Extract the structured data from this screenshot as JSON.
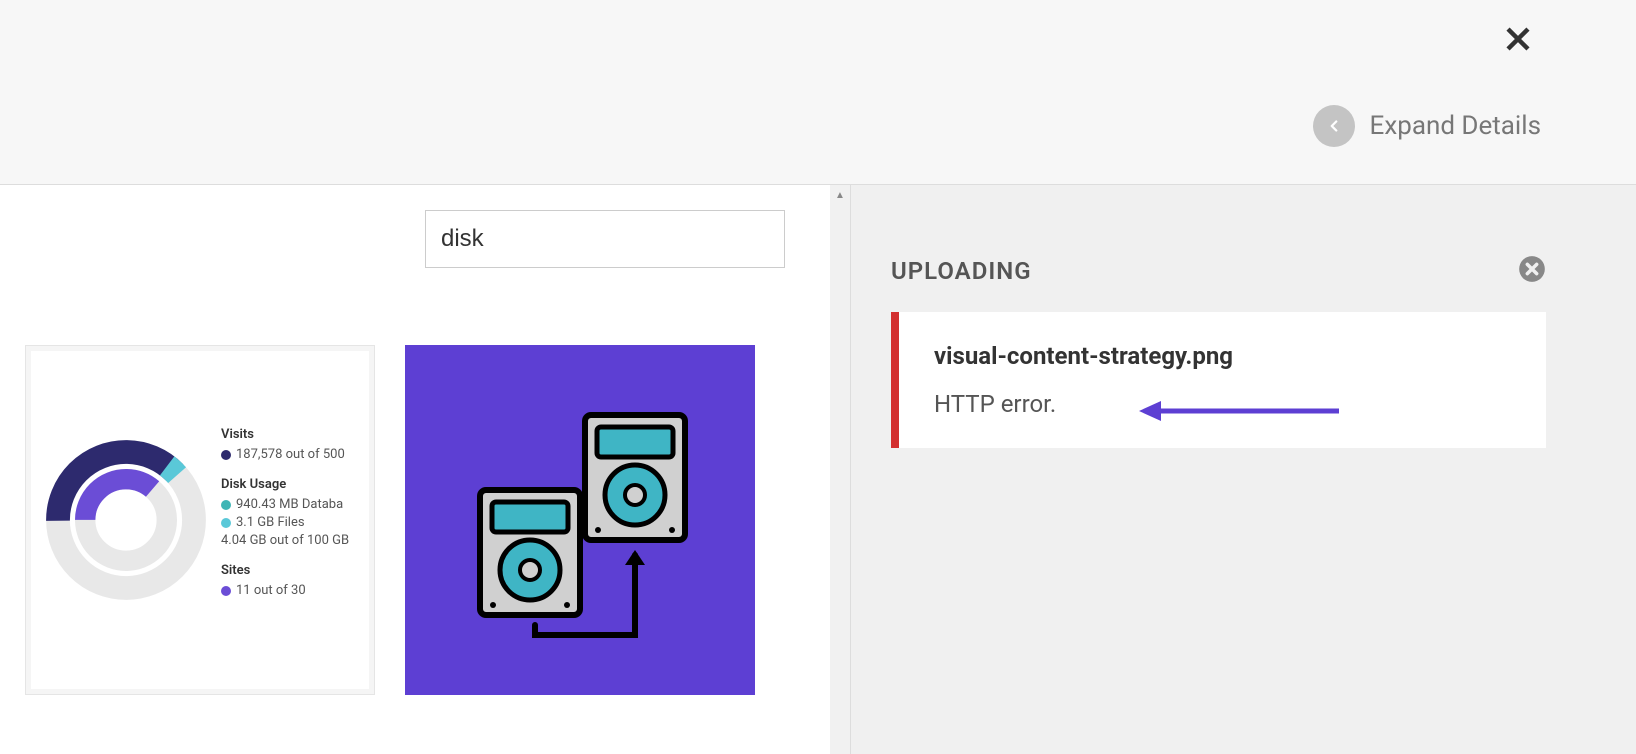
{
  "header": {
    "expand_label": "Expand Details"
  },
  "search": {
    "value": "disk"
  },
  "media": {
    "dashboard": {
      "visits": {
        "label": "Visits",
        "stat": "187,578 out of 500"
      },
      "disk_usage": {
        "label": "Disk Usage",
        "database": "940.43 MB Databa",
        "files": "3.1 GB Files",
        "total": "4.04 GB out of 100 GB"
      },
      "sites": {
        "label": "Sites",
        "stat": "11 out of 30"
      }
    }
  },
  "upload": {
    "title": "UPLOADING",
    "filename": "visual-content-strategy.png",
    "error": "HTTP error."
  }
}
